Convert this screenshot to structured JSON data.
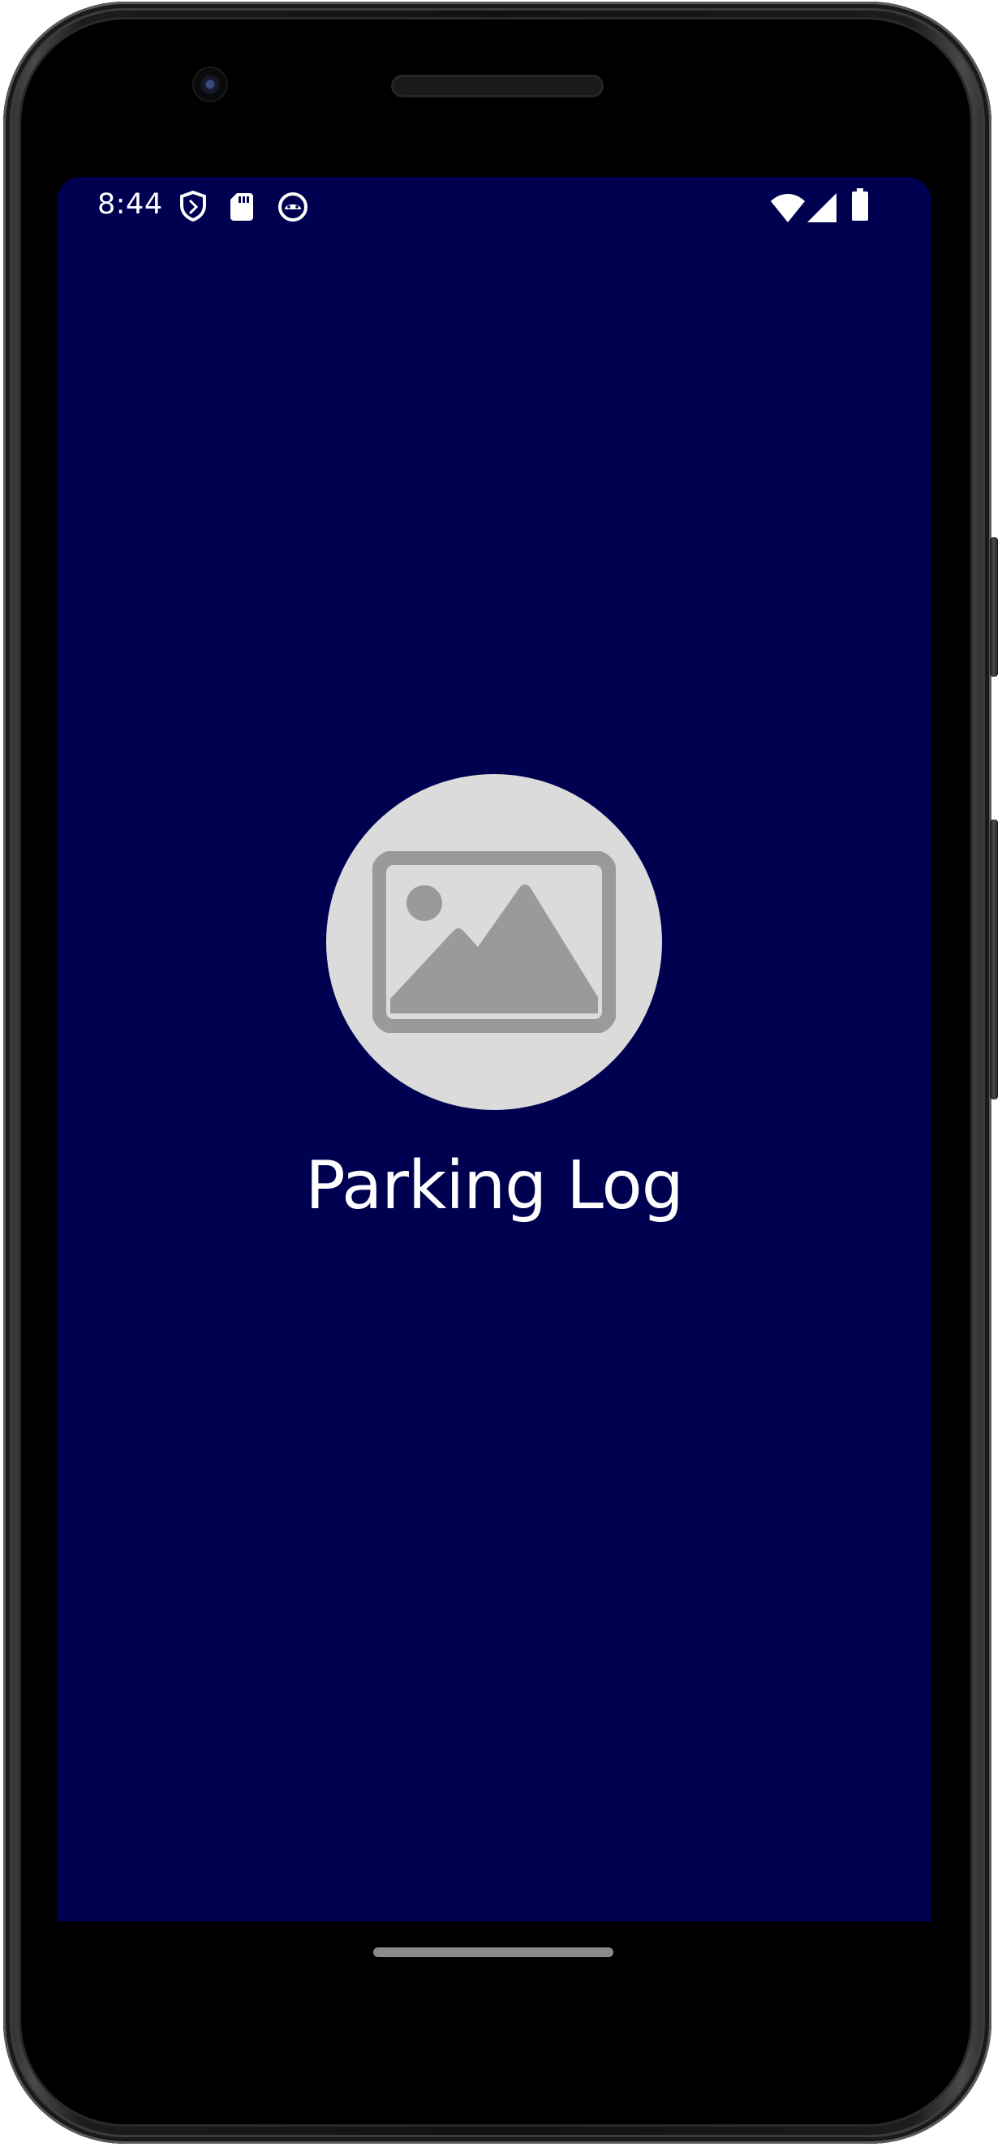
{
  "status_bar": {
    "time": "8:44",
    "left_icons": [
      "shield-icon",
      "sd-card-icon",
      "android-debug-icon"
    ],
    "right_icons": [
      "wifi-icon",
      "cell-signal-icon",
      "battery-icon"
    ]
  },
  "splash": {
    "logo_icon": "image-placeholder-icon",
    "app_name": "Parking Log"
  },
  "colors": {
    "screen_background": "#000050",
    "logo_circle": "#dbdbdb",
    "logo_glyph": "#9a9a9a",
    "text": "#ffffff"
  }
}
